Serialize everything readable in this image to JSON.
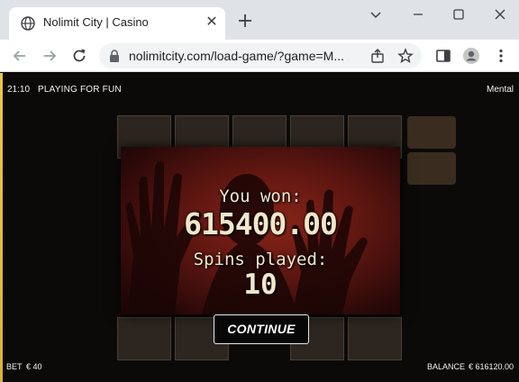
{
  "browser": {
    "tab_title": "Nolimit City | Casino",
    "url": "nolimitcity.com/load-game/?game=M...",
    "accent": "#1a73e8"
  },
  "game": {
    "clock": "21:10",
    "mode": "PLAYING FOR FUN",
    "name": "Mental",
    "win_dialog": {
      "you_won_label": "You won:",
      "amount": "615400.00",
      "spins_label": "Spins played:",
      "spins_value": "10",
      "continue_label": "CONTINUE"
    },
    "footer": {
      "bet_label": "BET",
      "bet_value": "€ 40",
      "balance_label": "BALANCE",
      "balance_value": "€ 616120.00"
    },
    "colors": {
      "panel_red": "#8a2518",
      "text_cream": "#f3e7c9",
      "sidebar_gold": "#e9c84a"
    }
  }
}
